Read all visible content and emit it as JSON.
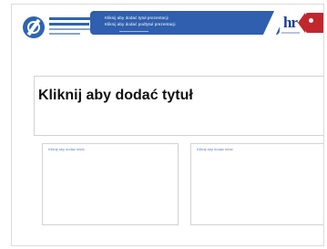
{
  "header": {
    "logo_name": "blue-circle-logo",
    "banner_lines": [
      "Kliknij aby dodać tytuł prezentacji",
      "Kliknij aby dodać podtytuł prezentacji"
    ],
    "hr_logo": "hr",
    "accent_colors": {
      "banner": "#2f5fae",
      "hr": "#1d3f8c",
      "tab": "#c1272d"
    }
  },
  "slide": {
    "title": "Kliknij aby dodać tytuł",
    "left_placeholder": "Kliknij aby dodać tekst",
    "right_placeholder": "Kliknij aby dodać tekst"
  }
}
